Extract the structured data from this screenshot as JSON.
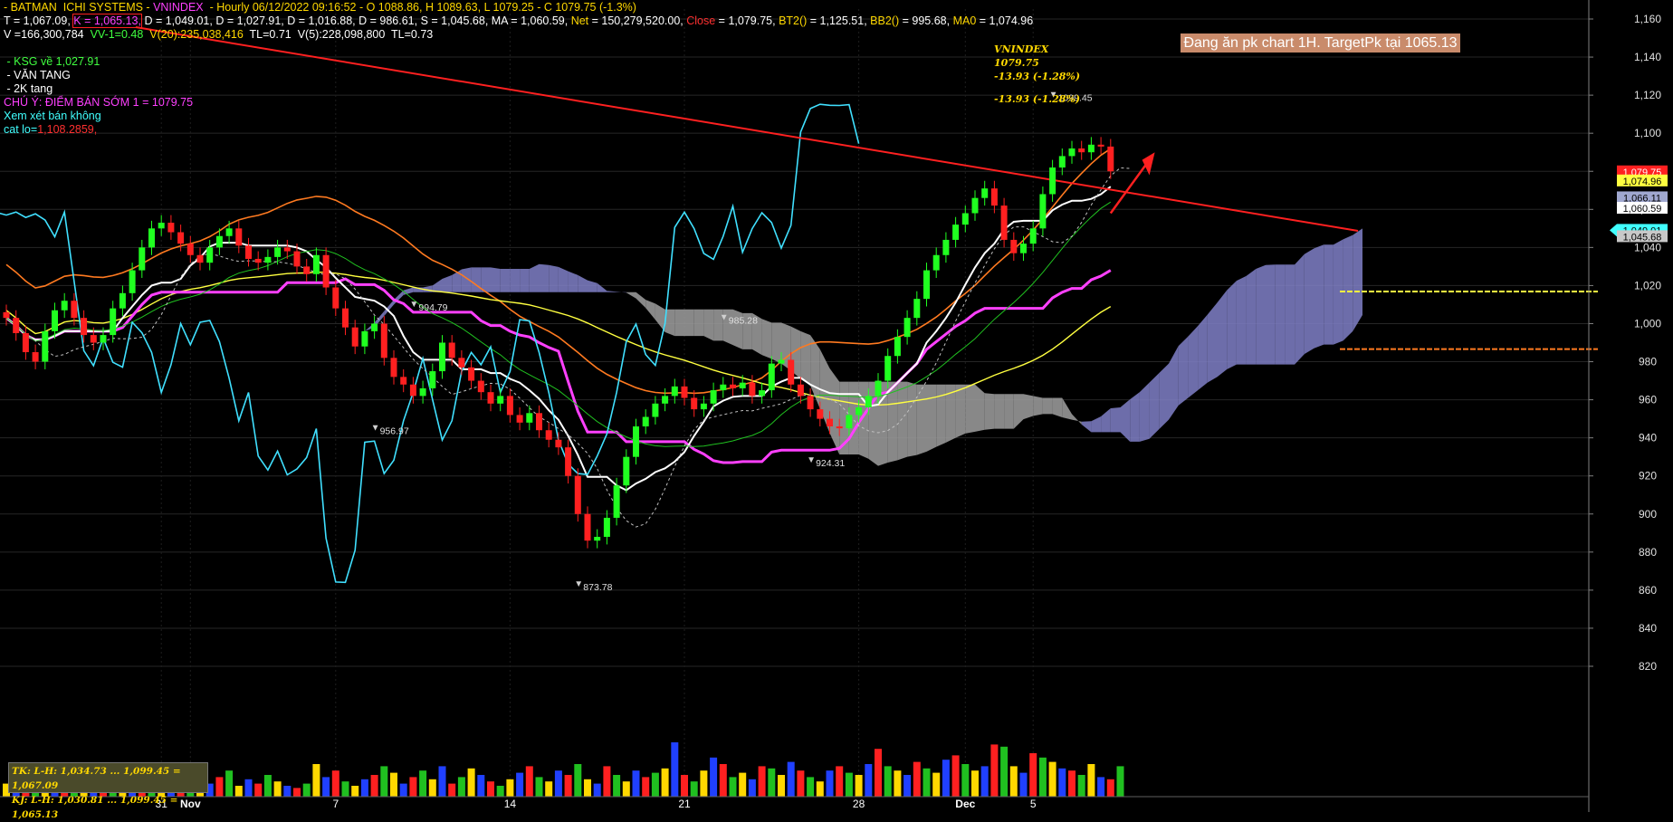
{
  "chart_data": {
    "type": "candlestick",
    "title": "BATMAN ICHI SYSTEMS - VNINDEX",
    "header_lines": [
      [
        {
          "text": "- BATMAN  ICHI SYSTEMS - ",
          "color": "#ffd800"
        },
        {
          "text": "VNINDEX",
          "color": "#ff40ff"
        },
        {
          "text": "  - Hourly 06/12/2022 09:16:52 - O 1088.86, H 1089.63, L 1079.25 - C 1079.75 (-1.3%)",
          "color": "#ffd800"
        }
      ],
      [
        {
          "text": "T = 1,067.09, ",
          "color": "#ffffff"
        },
        {
          "text": "K = 1,065.13,",
          "color": "#ff40ff",
          "boxed": true
        },
        {
          "text": " D = 1,049.01, ",
          "color": "#ffffff"
        },
        {
          "text": "D = 1,027.91, ",
          "color": "#ffffff"
        },
        {
          "text": "D = 1,016.88, ",
          "color": "#ffffff"
        },
        {
          "text": "D = 986.61, ",
          "color": "#ffffff"
        },
        {
          "text": "S = 1,045.68, ",
          "color": "#ffffff"
        },
        {
          "text": "MA = 1,060.59, ",
          "color": "#ffffff"
        },
        {
          "text": "Net",
          "color": "#ffd800"
        },
        {
          "text": " = 150,279,520.00, ",
          "color": "#ffffff"
        },
        {
          "text": "Close",
          "color": "#ff3030"
        },
        {
          "text": " = 1,079.75, ",
          "color": "#ffffff"
        },
        {
          "text": "BT2()",
          "color": "#ffd800"
        },
        {
          "text": " = 1,125.51, ",
          "color": "#ffffff"
        },
        {
          "text": "BB2()",
          "color": "#ffd800"
        },
        {
          "text": " = 995.68, ",
          "color": "#ffffff"
        },
        {
          "text": "MA0",
          "color": "#ffd800"
        },
        {
          "text": " = 1,074.96",
          "color": "#ffffff"
        }
      ],
      [
        {
          "text": "V =166,300,784  ",
          "color": "#ffffff"
        },
        {
          "text": "VV-1=0.48  ",
          "color": "#40ff40"
        },
        {
          "text": "V(20):235,038,416  ",
          "color": "#ffd800"
        },
        {
          "text": "TL=0.71  ",
          "color": "#ffffff"
        },
        {
          "text": "V(5):228,098,800  ",
          "color": "#ffffff"
        },
        {
          "text": "TL=0.73",
          "color": "#ffffff"
        }
      ]
    ],
    "notes": [
      [
        {
          "text": " - KSG về 1,027.91",
          "color": "#40ff40"
        }
      ],
      [
        {
          "text": " - VĂN TANG",
          "color": "#ffffff"
        }
      ],
      [
        {
          "text": " - 2K tang",
          "color": "#ffffff"
        }
      ],
      [
        {
          "text": "CHÚ Ý: ĐIỂM BÁN SỚM 1 = 1079.75",
          "color": "#ff40ff"
        }
      ],
      [
        {
          "text": "Xem xét bán không",
          "color": "#40ffff"
        }
      ],
      [
        {
          "text": "cat lo=",
          "color": "#40ffff"
        },
        {
          "text": "1,108.2859,",
          "color": "#ff3030"
        }
      ]
    ],
    "note_box": "Đang ăn pk chart 1H. TargetPk tại 1065.13",
    "vnindex_box": [
      "VNINDEX",
      "1079.75",
      "-13.93 (-1.28%)",
      "",
      "-13.93 (-1.28%)"
    ],
    "tk_kj_box": [
      "TK:  L-H: 1,034.73  ...  1,099.45  =  1,067.09",
      "KJ:  L-H: 1,030.81  ...  1,099.45  =  1,065.13"
    ],
    "ylim": [
      810,
      1170
    ],
    "y_ticks": [
      820,
      840,
      860,
      880,
      900,
      920,
      940,
      960,
      980,
      1000,
      1020,
      1040,
      1060,
      1080,
      1100,
      1120,
      1140,
      1160
    ],
    "x_ticks": [
      {
        "label": "31",
        "index": 16
      },
      {
        "label": "Nov",
        "index": 19,
        "bold": true
      },
      {
        "label": "7",
        "index": 34
      },
      {
        "label": "14",
        "index": 52
      },
      {
        "label": "21",
        "index": 70
      },
      {
        "label": "28",
        "index": 88
      },
      {
        "label": "Dec",
        "index": 99,
        "bold": true
      },
      {
        "label": "5",
        "index": 106
      }
    ],
    "price_tags": [
      {
        "value": 1079.75,
        "label": "1,079.75",
        "bg": "#ff2020",
        "fg": "#ffffff"
      },
      {
        "value": 1074.96,
        "label": "1,074.96",
        "bg": "#ffff40",
        "fg": "#000000"
      },
      {
        "value": 1066.11,
        "label": "1,066.11",
        "bg": "#a0a8d0",
        "fg": "#000000"
      },
      {
        "value": 1060.59,
        "label": "1,060.59",
        "bg": "#ffffff",
        "fg": "#000000"
      },
      {
        "value": 1049.01,
        "label": "1,049.01",
        "bg": "#40ffff",
        "fg": "#000000",
        "arrow": true
      },
      {
        "value": 1045.68,
        "label": "1,045.68",
        "bg": "#c8c8c8",
        "fg": "#000000"
      }
    ],
    "annotations": [
      {
        "label": "1099.45",
        "index": 108,
        "value": 1117
      },
      {
        "label": "994.79",
        "index": 42,
        "value": 1007
      },
      {
        "label": "985.28",
        "index": 74,
        "value": 1000
      },
      {
        "label": "956.97",
        "index": 38,
        "value": 942
      },
      {
        "label": "873.78",
        "index": 59,
        "value": 860
      },
      {
        "label": "924.31",
        "index": 83,
        "value": 925
      }
    ],
    "closes": [
      1003,
      995,
      985,
      980,
      996,
      1007,
      1012,
      1003,
      994,
      990,
      994,
      1008,
      1016,
      1028,
      1040,
      1050,
      1053,
      1048,
      1042,
      1036,
      1032,
      1040,
      1046,
      1050,
      1041,
      1034,
      1032,
      1035,
      1040,
      1038,
      1030,
      1026,
      1036,
      1019,
      1008,
      998,
      988,
      996,
      1000,
      982,
      972,
      968,
      962,
      966,
      975,
      990,
      982,
      977,
      970,
      964,
      958,
      962,
      952,
      948,
      953,
      944,
      939,
      935,
      920,
      900,
      886,
      888,
      898,
      915,
      930,
      946,
      951,
      958,
      962,
      967,
      961,
      955,
      958,
      965,
      968,
      966,
      969,
      962,
      965,
      979,
      981,
      968,
      962,
      955,
      950,
      946,
      945,
      952,
      956,
      962,
      970,
      983,
      993,
      1003,
      1013,
      1028,
      1036,
      1044,
      1052,
      1058,
      1066,
      1071,
      1062,
      1044,
      1037,
      1042,
      1050,
      1068,
      1082,
      1088,
      1092,
      1090,
      1094,
      1093,
      1080
    ],
    "volumes": [
      6,
      4,
      5,
      10,
      3,
      5,
      4,
      8,
      12,
      6,
      5,
      9,
      7,
      4,
      11,
      6,
      5,
      8,
      14,
      7,
      4,
      6,
      9,
      12,
      5,
      8,
      6,
      10,
      7,
      5,
      4,
      6,
      15,
      9,
      12,
      7,
      5,
      8,
      10,
      14,
      11,
      6,
      9,
      12,
      8,
      14,
      6,
      9,
      13,
      10,
      7,
      5,
      8,
      11,
      14,
      9,
      7,
      12,
      10,
      15,
      8,
      6,
      14,
      10,
      7,
      12,
      9,
      11,
      13,
      25,
      10,
      7,
      12,
      18,
      15,
      9,
      11,
      8,
      14,
      13,
      10,
      16,
      12,
      9,
      7,
      12,
      14,
      11,
      10,
      15,
      22,
      14,
      12,
      10,
      16,
      13,
      11,
      17,
      19,
      15,
      12,
      14,
      24,
      23,
      14,
      11,
      20,
      18,
      16,
      13,
      12,
      10,
      15,
      9,
      8,
      14
    ],
    "volume_colors": [
      "#ffd800",
      "#2040ff",
      "#ff2020",
      "#20c020",
      "#ffffff"
    ]
  }
}
